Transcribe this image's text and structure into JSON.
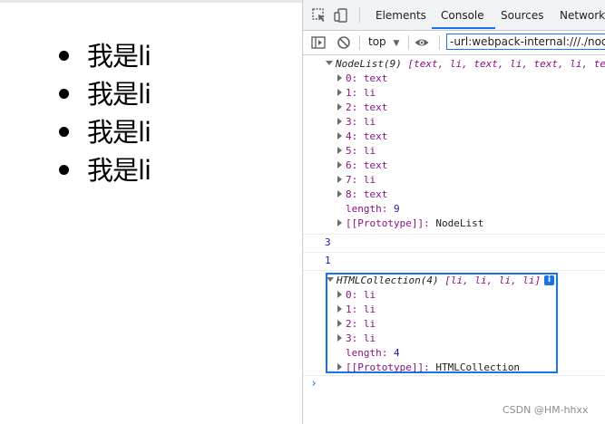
{
  "page": {
    "list_items": [
      "我是li",
      "我是li",
      "我是li",
      "我是li"
    ]
  },
  "devtools": {
    "tabs": [
      "Elements",
      "Console",
      "Sources",
      "Network"
    ],
    "active_tab": "Console",
    "context": "top",
    "filter_value": "-url:webpack-internal:///./node_m",
    "icons": [
      "inspect-icon",
      "device-toolbar-icon",
      "sidebar-toggle-icon",
      "clear-console-icon",
      "eye-icon"
    ],
    "accent_color": "#1a73e8"
  },
  "console": {
    "nodelist": {
      "summary_name": "NodeList(9)",
      "summary_items": "[text, li, text, li, text, li, tex",
      "entries": [
        {
          "key": "0:",
          "value": "text"
        },
        {
          "key": "1:",
          "value": "li"
        },
        {
          "key": "2:",
          "value": "text"
        },
        {
          "key": "3:",
          "value": "li"
        },
        {
          "key": "4:",
          "value": "text"
        },
        {
          "key": "5:",
          "value": "li"
        },
        {
          "key": "6:",
          "value": "text"
        },
        {
          "key": "7:",
          "value": "li"
        },
        {
          "key": "8:",
          "value": "text"
        }
      ],
      "length_key": "length:",
      "length_value": "9",
      "proto_key": "[[Prototype]]:",
      "proto_value": "NodeList"
    },
    "log_values": [
      "3",
      "1"
    ],
    "collection": {
      "summary_name": "HTMLCollection(4)",
      "summary_items": "[li, li, li, li]",
      "entries": [
        {
          "key": "0:",
          "value": "li"
        },
        {
          "key": "1:",
          "value": "li"
        },
        {
          "key": "2:",
          "value": "li"
        },
        {
          "key": "3:",
          "value": "li"
        }
      ],
      "length_key": "length:",
      "length_value": "4",
      "proto_key": "[[Prototype]]:",
      "proto_value": "HTMLCollection",
      "info_icon_text": "i"
    },
    "prompt_symbol": "›"
  },
  "watermark": "CSDN @HM-hhxx"
}
